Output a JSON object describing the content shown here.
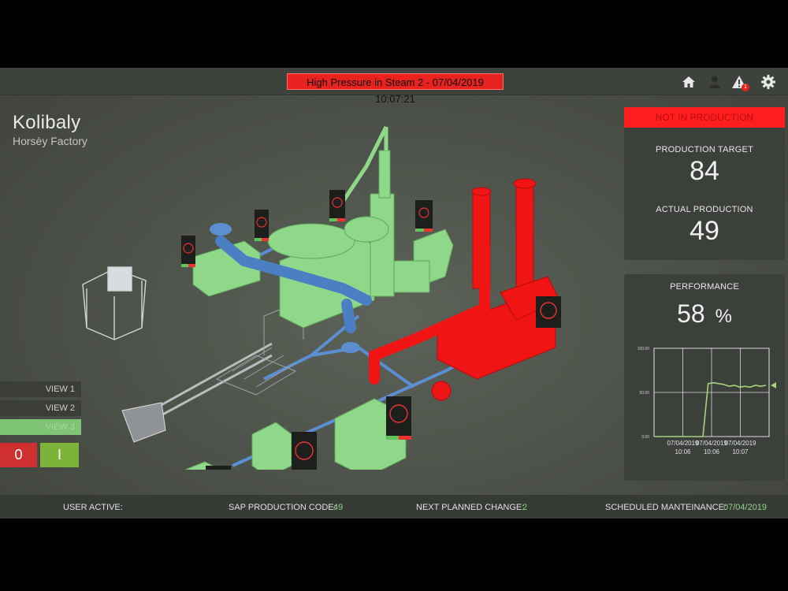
{
  "alarm": {
    "text": "High Pressure in Steam 2 - 07/04/2019 10:07:21"
  },
  "toolbar": {
    "icons": [
      "home-icon",
      "user-icon",
      "warning-icon",
      "gear-icon"
    ],
    "alert_count": "1"
  },
  "brand": {
    "title": "Kolibaly",
    "subtitle": "Horsèy Factory"
  },
  "views": [
    "VIEW 1",
    "VIEW 2",
    "VIEW 3"
  ],
  "controls": {
    "off_label": "0",
    "on_label": "I"
  },
  "status": {
    "label": "NOT IN PRODUCTION",
    "production_target_label": "PRODUCTION TARGET",
    "production_target": "84",
    "actual_production_label": "ACTUAL PRODUCTION",
    "actual_production": "49"
  },
  "performance": {
    "label": "PERFORMANCE",
    "value": "58",
    "unit": "%"
  },
  "chart_data": {
    "type": "line",
    "y_ticks": [
      "100.00",
      "50.00",
      "0.00"
    ],
    "x_ticks": [
      {
        "date": "07/04/2019",
        "time": "10:06"
      },
      {
        "date": "07/04/2019",
        "time": "10:06"
      },
      {
        "date": "07/04/2019",
        "time": "10:07"
      }
    ],
    "ylim": [
      0,
      100
    ],
    "series": [
      {
        "values": [
          0,
          0,
          0,
          0,
          0,
          0,
          0,
          0,
          0,
          0,
          60,
          61,
          60,
          59,
          57,
          58,
          56,
          57,
          56,
          58,
          57,
          58
        ]
      }
    ],
    "current_marker": 58,
    "grid": true
  },
  "footer": {
    "user_active_label": "USER ACTIVE:",
    "user_active_value": "",
    "sap_label": "SAP PRODUCTION CODE:",
    "sap_value": "49",
    "next_change_label": "NEXT PLANNED CHANGE:",
    "next_change_value": "2",
    "maintenance_label": "SCHEDULED MANTEINANCE:",
    "maintenance_value": "07/04/2019"
  },
  "colors": {
    "accent_green": "#8fd38a",
    "alarm_red": "#e8231f",
    "pipe_blue": "#4f86c9",
    "machine_green": "#7fd17a"
  }
}
